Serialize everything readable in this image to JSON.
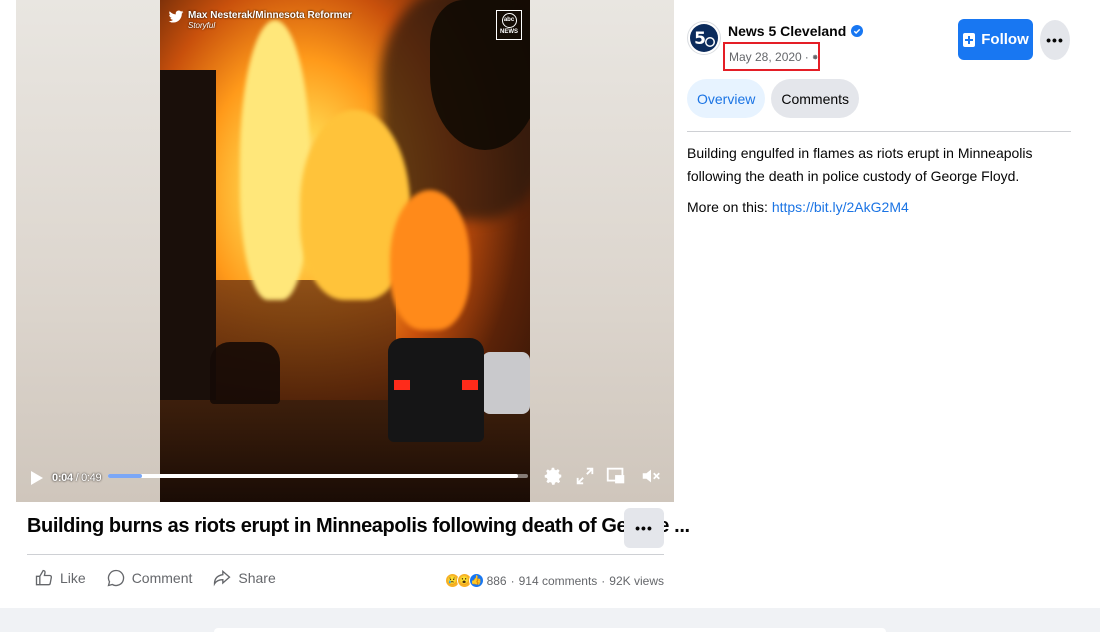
{
  "video": {
    "credit_name": "Max Nesterak/Minnesota Reformer",
    "credit_source": "Storyful",
    "logo_abc": "abc",
    "logo_news": "NEWS",
    "current_time": "0:04",
    "duration": "0:49",
    "time_separator": " / ",
    "progress_fraction": 0.082,
    "buffered_fraction": 0.975
  },
  "post": {
    "title": "Building burns as riots erupt in Minneapolis following death of George ...",
    "actions": {
      "like": "Like",
      "comment": "Comment",
      "share": "Share"
    },
    "reaction_icons": [
      "sad-reaction-icon",
      "wow-reaction-icon",
      "like-reaction-icon"
    ],
    "reaction_count": "886",
    "comments": "914 comments",
    "views": "92K views",
    "separator": "·"
  },
  "page": {
    "name": "News 5 Cleveland",
    "date": "May 28, 2020",
    "date_separator": "·",
    "follow_label": "Follow",
    "tabs": [
      {
        "label": "Overview",
        "active": true
      },
      {
        "label": "Comments",
        "active": false
      }
    ],
    "description": "Building engulfed in flames as riots erupt in Minneapolis following the death in police custody of George Floyd.",
    "more_label": "More on this: ",
    "more_link": "https://bit.ly/2AkG2M4"
  },
  "colors": {
    "accent": "#1877f2",
    "highlight_box": "#e41e26",
    "link": "#1b74e4"
  }
}
